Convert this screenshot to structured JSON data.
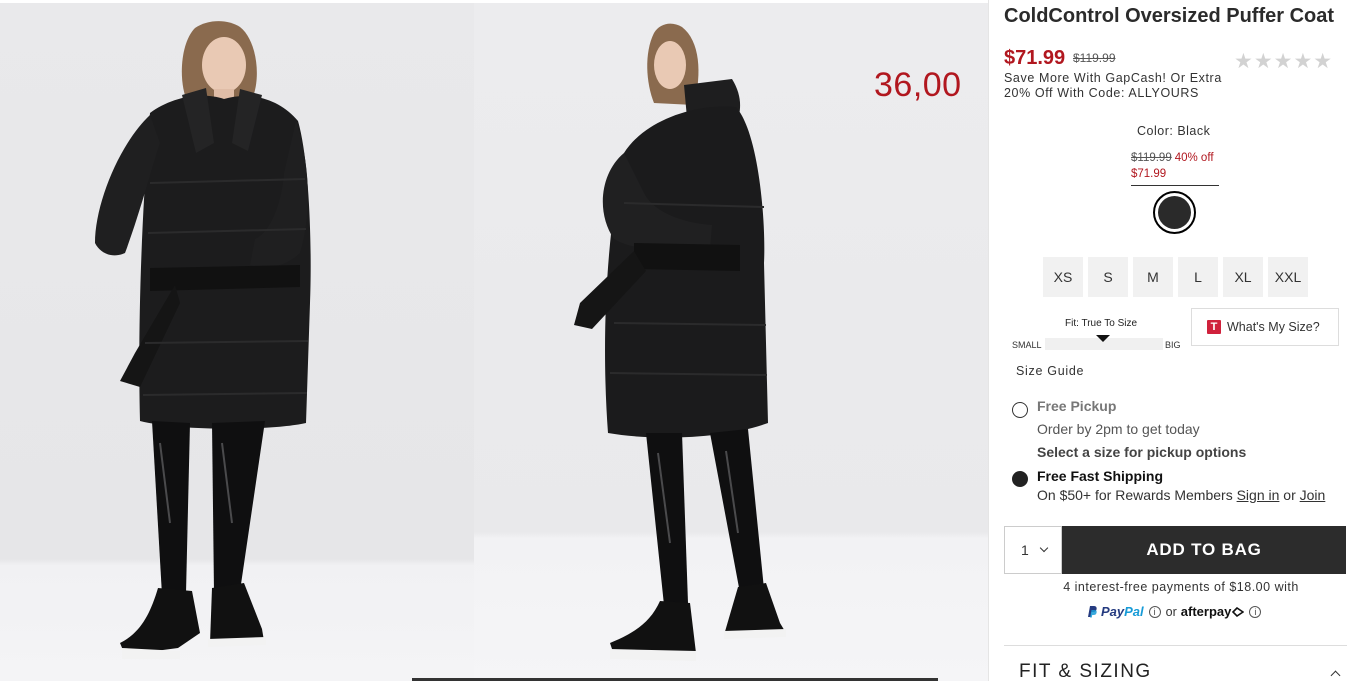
{
  "gallery": {
    "overlay_price": "36,00"
  },
  "product": {
    "title": "ColdControl Oversized Puffer Coat",
    "price_now": "$71.99",
    "price_was": "$119.99",
    "rating_stars": "★★★★★",
    "promo": "Save More With GapCash! Or Extra 20% Off With Code: ALLYOURS"
  },
  "color": {
    "label": "Color: Black",
    "swatch_was": "$119.99",
    "swatch_off": "40% off",
    "swatch_now": "$71.99",
    "swatch_color": "#2a2a2a"
  },
  "sizes": [
    "XS",
    "S",
    "M",
    "L",
    "XL",
    "XXL"
  ],
  "fit": {
    "title": "Fit: True To Size",
    "small": "SMALL",
    "big": "BIG",
    "whats_my_size": "What's My Size?",
    "logo": "T",
    "size_guide": "Size Guide"
  },
  "fulfillment": {
    "pickup_title": "Free Pickup",
    "pickup_sub": "Order by 2pm to get today",
    "pickup_note": "Select a size for pickup options",
    "ship_title": "Free Fast Shipping",
    "ship_sub": "On $50+ for Rewards Members",
    "sign_in": "Sign in",
    "or": "or",
    "join": "Join"
  },
  "cart": {
    "qty": "1",
    "add_to_bag": "ADD TO BAG",
    "installments": "4 interest-free payments of $18.00 with",
    "paypal_a": "Pay",
    "paypal_b": "Pal",
    "or": "or",
    "afterpay": "afterpay"
  },
  "sections": {
    "fit_sizing": "FIT & SIZING"
  },
  "colors": {
    "accent_red": "#b1171f",
    "button_dark": "#2c2c2c"
  }
}
